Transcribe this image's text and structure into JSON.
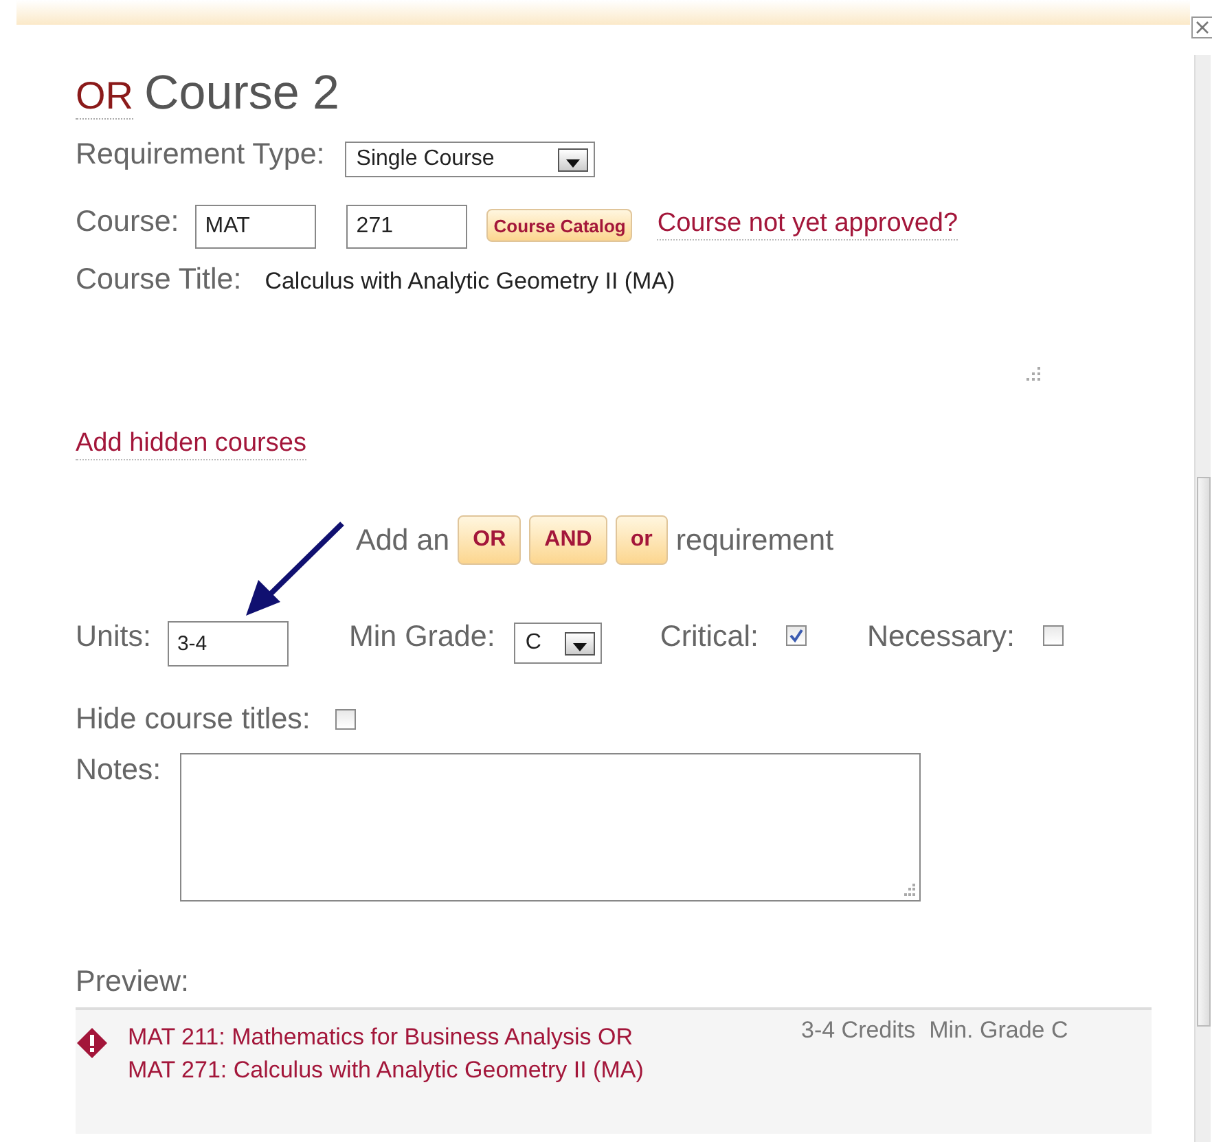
{
  "title": {
    "prefix": "OR",
    "text": "Course 2"
  },
  "requirement_type": {
    "label": "Requirement Type:",
    "value": "Single Course"
  },
  "course": {
    "label": "Course:",
    "subject": "MAT",
    "number": "271",
    "catalog_button": "Course Catalog",
    "not_approved_link": "Course not yet approved?"
  },
  "course_title": {
    "label": "Course Title:",
    "value": "Calculus with Analytic Geometry II (MA)"
  },
  "hidden_courses_link": "Add hidden courses",
  "add_requirement": {
    "before": "Add an",
    "buttons": [
      "OR",
      "AND",
      "or"
    ],
    "after": "requirement"
  },
  "units": {
    "label": "Units:",
    "value": "3-4"
  },
  "min_grade": {
    "label": "Min Grade:",
    "value": "C"
  },
  "flags": [
    {
      "label": "Critical:",
      "checked": true
    },
    {
      "label": "Necessary:",
      "checked": false
    }
  ],
  "hide_titles": {
    "label": "Hide course titles:",
    "checked": false
  },
  "notes": {
    "label": "Notes:"
  },
  "preview": {
    "label": "Preview:",
    "lines": [
      "MAT 211: Mathematics for Business Analysis OR",
      "MAT 271: Calculus with Analytic Geometry II (MA)"
    ],
    "credits": "3-4 Credits",
    "grade": "Min. Grade C"
  }
}
